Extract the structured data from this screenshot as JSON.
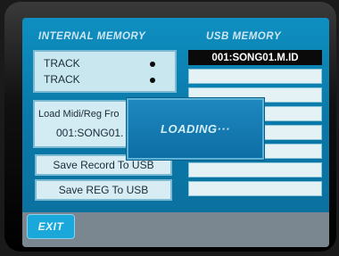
{
  "headers": {
    "internal": "INTERNAL MEMORY",
    "usb": "USB MEMORY"
  },
  "internal_memory": {
    "tracks": [
      {
        "label": "TRACK",
        "indicator": "dot"
      },
      {
        "label": "TRACK",
        "indicator": "dot"
      }
    ],
    "load": {
      "title": "Load Midi/Reg Fro",
      "file": "001:SONG01."
    },
    "buttons": {
      "save_record": "Save Record To USB",
      "save_reg": "Save REG To USB"
    }
  },
  "usb_memory": {
    "files": [
      "001:SONG01.M.ID",
      "",
      "",
      "",
      "",
      "",
      "",
      ""
    ],
    "selected_index": 0
  },
  "overlay": {
    "loading_text": "LOADING···"
  },
  "footer": {
    "exit_label": "EXIT"
  },
  "colors": {
    "screen_blue": "#0a78a8",
    "selected_row_bg": "#0a0a0a",
    "panel_light": "#d3ebf2",
    "footer_gray": "#7a8791",
    "exit_blue": "#1aa7d9"
  }
}
